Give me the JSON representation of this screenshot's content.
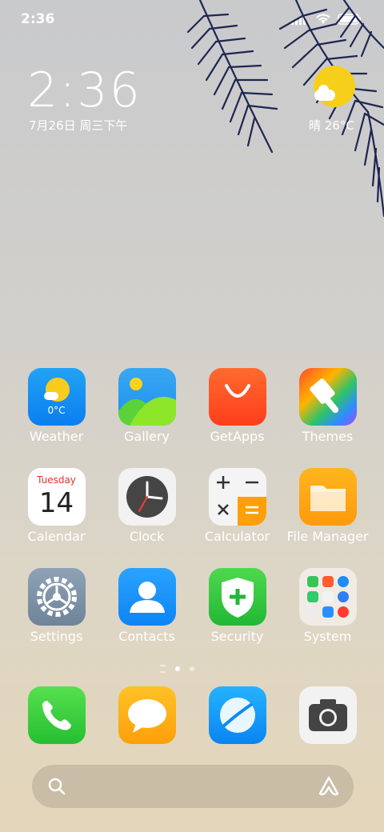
{
  "status_bar": {
    "time": "2:36"
  },
  "clock": {
    "time": "2:36",
    "date": "7月26日 周三下午"
  },
  "weather_widget": {
    "text": "晴 26°C"
  },
  "apps": [
    {
      "label": "Weather",
      "icon": "weather-icon",
      "badge": "0°C"
    },
    {
      "label": "Gallery",
      "icon": "gallery-icon"
    },
    {
      "label": "GetApps",
      "icon": "getapps-icon"
    },
    {
      "label": "Themes",
      "icon": "themes-icon"
    },
    {
      "label": "Calendar",
      "icon": "calendar-icon",
      "weekday": "Tuesday",
      "day": "14"
    },
    {
      "label": "Clock",
      "icon": "clock-icon"
    },
    {
      "label": "Calculator",
      "icon": "calculator-icon"
    },
    {
      "label": "File Manager",
      "icon": "folder-icon"
    },
    {
      "label": "Settings",
      "icon": "gear-icon"
    },
    {
      "label": "Contacts",
      "icon": "contacts-icon"
    },
    {
      "label": "Security",
      "icon": "shield-icon"
    },
    {
      "label": "System",
      "icon": "system-folder-icon"
    }
  ],
  "dock": [
    {
      "icon": "phone-icon"
    },
    {
      "icon": "messages-icon"
    },
    {
      "icon": "browser-icon"
    },
    {
      "icon": "camera-icon"
    }
  ],
  "colors": {
    "sun": "#f6cf1a",
    "label": "#ffffff"
  }
}
